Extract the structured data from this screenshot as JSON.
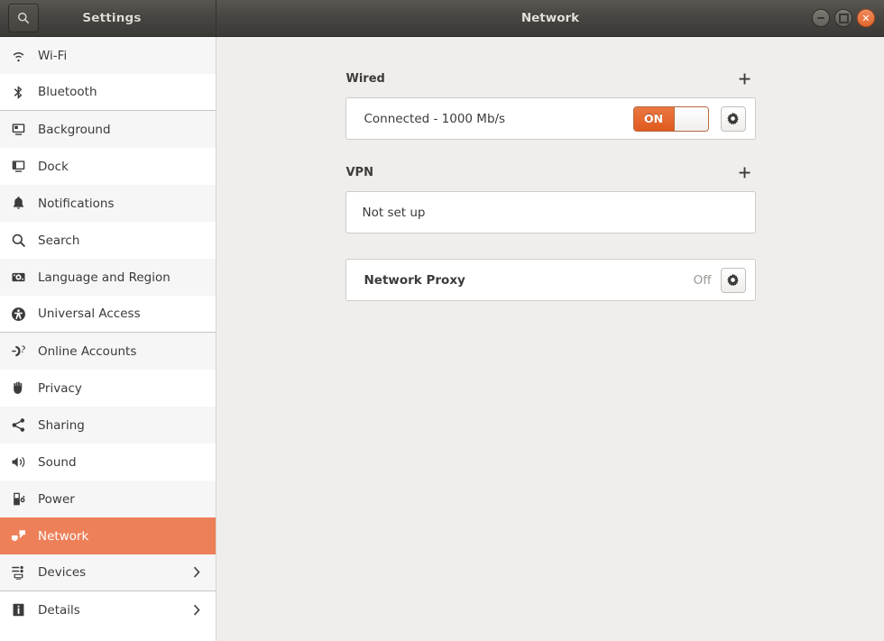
{
  "window": {
    "app_title": "Settings",
    "page_title": "Network",
    "search_icon": "search-icon",
    "controls": {
      "minimize_label": "Minimize",
      "maximize_label": "Maximize",
      "close_label": "Close"
    }
  },
  "sidebar": {
    "items": [
      {
        "label": "Wi-Fi",
        "icon": "wifi-icon",
        "selected": false,
        "chevron": false,
        "alt": true,
        "separator_after": false
      },
      {
        "label": "Bluetooth",
        "icon": "bluetooth-icon",
        "selected": false,
        "chevron": false,
        "alt": false,
        "separator_after": true
      },
      {
        "label": "Background",
        "icon": "background-icon",
        "selected": false,
        "chevron": false,
        "alt": true,
        "separator_after": false
      },
      {
        "label": "Dock",
        "icon": "dock-icon",
        "selected": false,
        "chevron": false,
        "alt": false,
        "separator_after": false
      },
      {
        "label": "Notifications",
        "icon": "bell-icon",
        "selected": false,
        "chevron": false,
        "alt": true,
        "separator_after": false
      },
      {
        "label": "Search",
        "icon": "search-icon",
        "selected": false,
        "chevron": false,
        "alt": false,
        "separator_after": false
      },
      {
        "label": "Language and Region",
        "icon": "language-region-icon",
        "selected": false,
        "chevron": false,
        "alt": true,
        "separator_after": false
      },
      {
        "label": "Universal Access",
        "icon": "universal-access-icon",
        "selected": false,
        "chevron": false,
        "alt": false,
        "separator_after": true
      },
      {
        "label": "Online Accounts",
        "icon": "online-accounts-icon",
        "selected": false,
        "chevron": false,
        "alt": true,
        "separator_after": false
      },
      {
        "label": "Privacy",
        "icon": "privacy-hand-icon",
        "selected": false,
        "chevron": false,
        "alt": false,
        "separator_after": false
      },
      {
        "label": "Sharing",
        "icon": "sharing-icon",
        "selected": false,
        "chevron": false,
        "alt": true,
        "separator_after": false
      },
      {
        "label": "Sound",
        "icon": "sound-icon",
        "selected": false,
        "chevron": false,
        "alt": false,
        "separator_after": false
      },
      {
        "label": "Power",
        "icon": "power-icon",
        "selected": false,
        "chevron": false,
        "alt": true,
        "separator_after": false
      },
      {
        "label": "Network",
        "icon": "network-icon",
        "selected": true,
        "chevron": false,
        "alt": false,
        "separator_after": false
      },
      {
        "label": "Devices",
        "icon": "devices-icon",
        "selected": false,
        "chevron": true,
        "alt": true,
        "separator_after": true
      },
      {
        "label": "Details",
        "icon": "details-info-icon",
        "selected": false,
        "chevron": true,
        "alt": false,
        "separator_after": false
      }
    ]
  },
  "main": {
    "wired": {
      "title": "Wired",
      "add_label": "+",
      "status": "Connected - 1000 Mb/s",
      "toggle_state": "ON",
      "settings_icon": "gear-icon"
    },
    "vpn": {
      "title": "VPN",
      "add_label": "+",
      "status": "Not set up"
    },
    "proxy": {
      "label": "Network Proxy",
      "value": "Off",
      "settings_icon": "gear-icon"
    }
  },
  "colors": {
    "accent_selected": "#ed8059",
    "accent_toggle": "#e05a1d",
    "titlebar": "#474541",
    "panel_bg": "#f0eeec"
  }
}
